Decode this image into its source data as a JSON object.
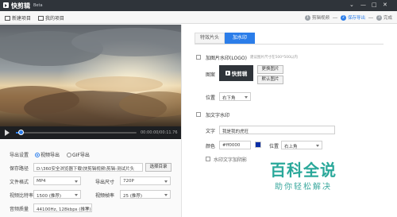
{
  "titlebar": {
    "app_name": "快剪辑",
    "badge": "Beta",
    "controls": [
      "⌄",
      "—",
      "□",
      "✕"
    ]
  },
  "toolbar": {
    "new_project": "新建项目",
    "my_projects": "我的项目",
    "steps": [
      {
        "num": "1",
        "label": "剪辑视频",
        "active": false
      },
      {
        "num": "2",
        "label": "保存导出",
        "active": true
      },
      {
        "num": "3",
        "label": "完成",
        "active": false
      }
    ]
  },
  "player": {
    "time": "00:00:00/00:11.76",
    "progress": 0.04
  },
  "export": {
    "export_settings_label": "导出设置",
    "video_export": "视频导出",
    "gif_export": "GIF导出",
    "save_path_label": "保存路径",
    "save_path_value": "D:\\360安全浏览器下载\\快剪辑视频\\剪辑-测试片头",
    "choose_dir": "选择目录",
    "file_format_label": "文件格式",
    "file_format_value": "MP4",
    "export_size_label": "导出尺寸",
    "export_size_value": "720P",
    "video_bitrate_label": "视频比特率",
    "video_bitrate_value": "1500 (推荐)",
    "video_framerate_label": "视频帧率",
    "video_framerate_value": "25 (推荐)",
    "audio_quality_label": "音频质量",
    "audio_quality_value": "44100Hz, 128kbps (推荐)"
  },
  "right": {
    "tabs": [
      "特效片头",
      "加水印"
    ],
    "add_image_wm": "加图片水印(LOGO)",
    "add_image_hint": "建议图片尺寸在500*500以内",
    "icon_label": "图案",
    "logo_text": "快剪辑",
    "change_image": "更换图片",
    "default_image": "默认图片",
    "position_label": "位置",
    "position_value_1": "右下角",
    "add_text_wm": "加文字水印",
    "text_label": "文字",
    "text_value": "我是我的虎旺",
    "color_label": "颜色",
    "color_value": "#ff0000",
    "color_swatch": "#0a2ea6",
    "position_value_2": "右上角",
    "text_dynamic": "水印文字加阴影"
  },
  "watermark": {
    "title": "百科全说",
    "subtitle": "助你轻松解决"
  }
}
